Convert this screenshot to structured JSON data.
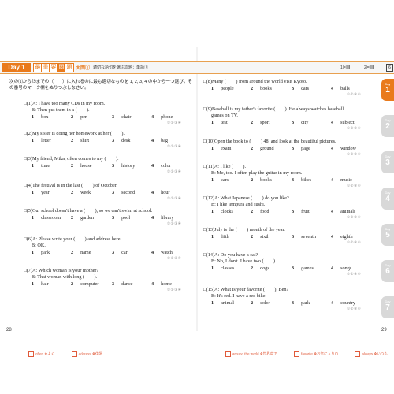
{
  "left": {
    "day_badge": "Day 1",
    "header_kanji": [
      "最",
      "重",
      "要",
      "問",
      "題"
    ],
    "q_badge": "大問①",
    "q_title": "適切な語句を選ぶ問題：単語①",
    "instructions": "次の⑴から⒀までの（　　）に入れるのに最も適切なものを 1, 2, 3, 4 の中から一つ選び，その番号のマーク欄をぬりつぶしなさい。",
    "page_number": "28",
    "footer": [
      "often ❖よく",
      "address ❖住所"
    ]
  },
  "right": {
    "score_label": "1回目",
    "score_label2": "2回目",
    "score_total": "6",
    "page_number": "29",
    "footer": [
      "around the world ❖世界中で",
      "favorite ❖お気に入りの",
      "always ❖いつも"
    ]
  },
  "questions_left": [
    {
      "num": "□(1)",
      "q": "A: I have too many CDs in my room.",
      "b": "B: Then put them in a (　　).",
      "opts": [
        "box",
        "pen",
        "chair",
        "phone"
      ]
    },
    {
      "num": "□(2)",
      "q": "My sister is doing her homework at her (　　).",
      "b": "",
      "opts": [
        "letter",
        "shirt",
        "desk",
        "bag"
      ]
    },
    {
      "num": "□(3)",
      "q": "My friend, Mika, often comes to my (　　).",
      "b": "",
      "opts": [
        "time",
        "house",
        "history",
        "color"
      ]
    },
    {
      "num": "□(4)",
      "q": "The festival is in the last (　　) of October.",
      "b": "",
      "opts": [
        "year",
        "week",
        "second",
        "hour"
      ]
    },
    {
      "num": "□(5)",
      "q": "Our school doesn't have a (　　), so we can't swim at school.",
      "b": "",
      "opts": [
        "classroom",
        "garden",
        "pool",
        "library"
      ]
    },
    {
      "num": "□(6)",
      "q": "A: Please write your (　　) and address here.",
      "b": "B: OK.",
      "opts": [
        "park",
        "name",
        "car",
        "watch"
      ]
    },
    {
      "num": "□(7)",
      "q": "A: Which woman is your mother?",
      "b": "B: That woman with long (　　).",
      "opts": [
        "hair",
        "computer",
        "dance",
        "home"
      ]
    }
  ],
  "questions_right": [
    {
      "num": "□(8)",
      "q": "Many (　　) from around the world visit Kyoto.",
      "b": "",
      "opts": [
        "people",
        "books",
        "cars",
        "balls"
      ]
    },
    {
      "num": "□(9)",
      "q": "Baseball is my father's favorite (　　). He always watches baseball",
      "b": "games on TV.",
      "opts": [
        "test",
        "sport",
        "city",
        "subject"
      ]
    },
    {
      "num": "□(10)",
      "q": "Open the book to (　　) 48, and look at the beautiful pictures.",
      "b": "",
      "opts": [
        "exam",
        "ground",
        "page",
        "window"
      ]
    },
    {
      "num": "□(11)",
      "q": "A: I like (　　).",
      "b": "B: Me, too. I often play the guitar in my room.",
      "opts": [
        "cars",
        "books",
        "bikes",
        "music"
      ]
    },
    {
      "num": "□(12)",
      "q": "A: What Japanese (　　) do you like?",
      "b": "B: I like tempura and sushi.",
      "opts": [
        "clocks",
        "food",
        "fruit",
        "animals"
      ]
    },
    {
      "num": "□(13)",
      "q": "July is the (　　) month of the year.",
      "b": "",
      "opts": [
        "fifth",
        "sixth",
        "seventh",
        "eighth"
      ]
    },
    {
      "num": "□(14)",
      "q": "A: Do you have a cat?",
      "b": "B: No, I don't. I have two (　　).",
      "opts": [
        "classes",
        "dogs",
        "games",
        "songs"
      ]
    },
    {
      "num": "□(15)",
      "q": "A: What is your favorite (　　), Ben?",
      "b": "B: It's red. I have a red bike.",
      "opts": [
        "animal",
        "color",
        "park",
        "country"
      ]
    }
  ],
  "bubbles": "①②③④",
  "day_tabs": [
    {
      "label": "Day",
      "num": "1",
      "active": true
    },
    {
      "label": "Day",
      "num": "2",
      "active": false
    },
    {
      "label": "Day",
      "num": "3",
      "active": false
    },
    {
      "label": "Day",
      "num": "4",
      "active": false
    },
    {
      "label": "Day",
      "num": "5",
      "active": false
    },
    {
      "label": "Day",
      "num": "6",
      "active": false
    },
    {
      "label": "Day",
      "num": "7",
      "active": false
    }
  ],
  "colors": {
    "accent": "#e97a1c",
    "tab_inactive": "#d8d8d8"
  }
}
